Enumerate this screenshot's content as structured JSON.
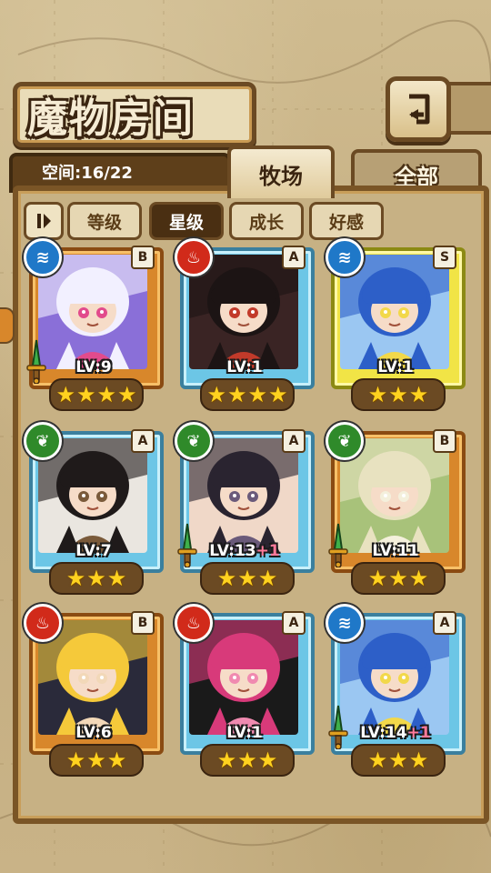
{
  "header": {
    "title": "魔物房间"
  },
  "space": {
    "text": "空间:16/22"
  },
  "tabs": [
    {
      "label": "牧场",
      "active": true
    },
    {
      "label": "全部",
      "active": false
    }
  ],
  "sort": {
    "toggle_icon": "pause-icon",
    "buttons": [
      {
        "label": "等级",
        "active": false
      },
      {
        "label": "星级",
        "active": true
      },
      {
        "label": "成长",
        "active": false
      },
      {
        "label": "好感",
        "active": false
      }
    ]
  },
  "monsters": [
    {
      "element": "water",
      "rank": "B",
      "frame": "orange",
      "lv": "LV:9",
      "plus": "",
      "stars": 4,
      "weapon": true,
      "palette": [
        "#f2f0ff",
        "#8a6fd8",
        "#e24b8c"
      ]
    },
    {
      "element": "fire",
      "rank": "A",
      "frame": "blue",
      "lv": "LV:1",
      "plus": "",
      "stars": 4,
      "weapon": false,
      "palette": [
        "#1c1414",
        "#3a2424",
        "#c23a2a"
      ]
    },
    {
      "element": "water",
      "rank": "S",
      "frame": "yellow",
      "lv": "LV:1",
      "plus": "",
      "stars": 3,
      "weapon": false,
      "palette": [
        "#2d5fc8",
        "#9bc7f2",
        "#f2d84a"
      ]
    },
    {
      "element": "wood",
      "rank": "A",
      "frame": "blue",
      "lv": "LV:7",
      "plus": "",
      "stars": 3,
      "weapon": false,
      "palette": [
        "#1f1a1a",
        "#eae6e0",
        "#7a5a3a"
      ]
    },
    {
      "element": "wood",
      "rank": "A",
      "frame": "blue",
      "lv": "LV:13",
      "plus": "+1",
      "stars": 3,
      "weapon": true,
      "palette": [
        "#2a2430",
        "#f0d8c8",
        "#6a5a7a"
      ]
    },
    {
      "element": "wood",
      "rank": "B",
      "frame": "orange",
      "lv": "LV:11",
      "plus": "",
      "stars": 3,
      "weapon": true,
      "palette": [
        "#e8e2c0",
        "#a8c27a",
        "#f4f0dc"
      ]
    },
    {
      "element": "fire",
      "rank": "B",
      "frame": "orange",
      "lv": "LV:6",
      "plus": "",
      "stars": 3,
      "weapon": false,
      "palette": [
        "#f5c93a",
        "#2a2a3a",
        "#f2d8b8"
      ]
    },
    {
      "element": "fire",
      "rank": "A",
      "frame": "blue",
      "lv": "LV:1",
      "plus": "",
      "stars": 3,
      "weapon": false,
      "palette": [
        "#d83a7a",
        "#1a1a1a",
        "#f08ab0"
      ]
    },
    {
      "element": "water",
      "rank": "A",
      "frame": "blue",
      "lv": "LV:14",
      "plus": "+1",
      "stars": 3,
      "weapon": true,
      "palette": [
        "#2d5fc8",
        "#9bc7f2",
        "#f2d84a"
      ]
    }
  ]
}
